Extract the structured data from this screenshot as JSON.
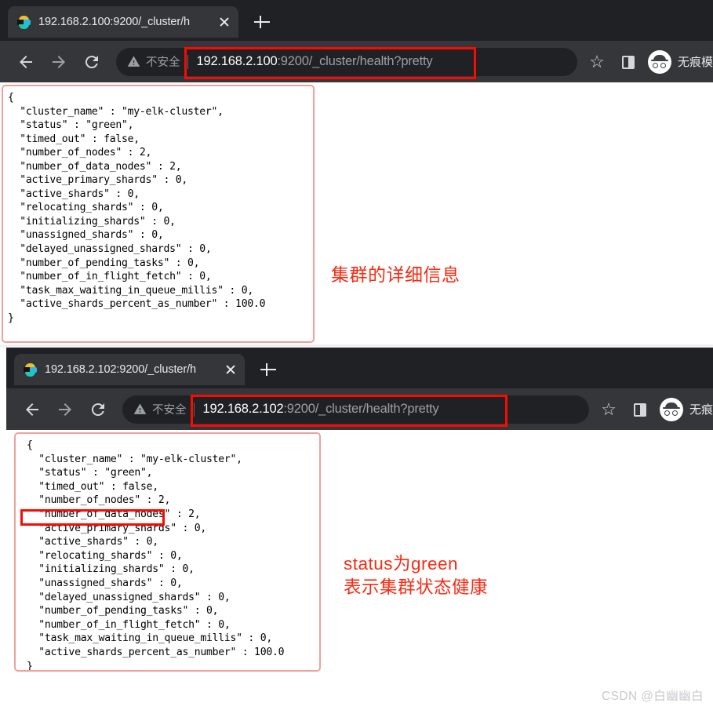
{
  "windows": [
    {
      "tab": {
        "title": "192.168.2.100:9200/_cluster/h",
        "favicon": "elasticsearch-icon",
        "close_label": "",
        "newtab_label": ""
      },
      "toolbar": {
        "back_label": "back-icon",
        "forward_label": "forward-icon",
        "reload_label": "reload-icon",
        "security_text": "不安全",
        "url_host": "192.168.2.100",
        "url_rest": ":9200/_cluster/health?pretty",
        "full_url": "192.168.2.100:9200/_cluster/health?pretty",
        "bookmark_label": "☆",
        "side_panel_label": "side-panel-icon",
        "profile_label": "无痕模"
      },
      "body": {
        "json_text": "{\n  \"cluster_name\" : \"my-elk-cluster\",\n  \"status\" : \"green\",\n  \"timed_out\" : false,\n  \"number_of_nodes\" : 2,\n  \"number_of_data_nodes\" : 2,\n  \"active_primary_shards\" : 0,\n  \"active_shards\" : 0,\n  \"relocating_shards\" : 0,\n  \"initializing_shards\" : 0,\n  \"unassigned_shards\" : 0,\n  \"delayed_unassigned_shards\" : 0,\n  \"number_of_pending_tasks\" : 0,\n  \"number_of_in_flight_fetch\" : 0,\n  \"task_max_waiting_in_queue_millis\" : 0,\n  \"active_shards_percent_as_number\" : 100.0\n}",
        "annotation": "集群的详细信息"
      }
    },
    {
      "tab": {
        "title": "192.168.2.102:9200/_cluster/h",
        "favicon": "elasticsearch-icon",
        "close_label": "",
        "newtab_label": ""
      },
      "toolbar": {
        "back_label": "back-icon",
        "forward_label": "forward-icon",
        "reload_label": "reload-icon",
        "security_text": "不安全",
        "url_host": "192.168.2.102",
        "url_rest": ":9200/_cluster/health?pretty",
        "full_url": "192.168.2.102:9200/_cluster/health?pretty",
        "bookmark_label": "☆",
        "side_panel_label": "side-panel-icon",
        "profile_label": "无痕"
      },
      "body": {
        "json_text": "{\n  \"cluster_name\" : \"my-elk-cluster\",\n  \"status\" : \"green\",\n  \"timed_out\" : false,\n  \"number_of_nodes\" : 2,\n  \"number_of_data_nodes\" : 2,\n  \"active_primary_shards\" : 0,\n  \"active_shards\" : 0,\n  \"relocating_shards\" : 0,\n  \"initializing_shards\" : 0,\n  \"unassigned_shards\" : 0,\n  \"delayed_unassigned_shards\" : 0,\n  \"number_of_pending_tasks\" : 0,\n  \"number_of_in_flight_fetch\" : 0,\n  \"task_max_waiting_in_queue_millis\" : 0,\n  \"active_shards_percent_as_number\" : 100.0\n}",
        "annotation": "status为green\n表示集群状态健康"
      }
    }
  ],
  "cluster_health": {
    "cluster_name": "my-elk-cluster",
    "status": "green",
    "timed_out": "false",
    "number_of_nodes": "2",
    "number_of_data_nodes": "2",
    "active_primary_shards": "0",
    "active_shards": "0",
    "relocating_shards": "0",
    "initializing_shards": "0",
    "unassigned_shards": "0",
    "delayed_unassigned_shards": "0",
    "number_of_pending_tasks": "0",
    "number_of_in_flight_fetch": "0",
    "task_max_waiting_in_queue_millis": "0",
    "active_shards_percent_as_number": "100.0"
  },
  "watermark": "CSDN @白幽幽白",
  "colors": {
    "annotation_red": "#fa2a12",
    "highlight_red": "#fa0a00",
    "frame_pink": "#f0a0a0",
    "chrome_dark": "#202124",
    "toolbar_dark": "#35363a"
  }
}
